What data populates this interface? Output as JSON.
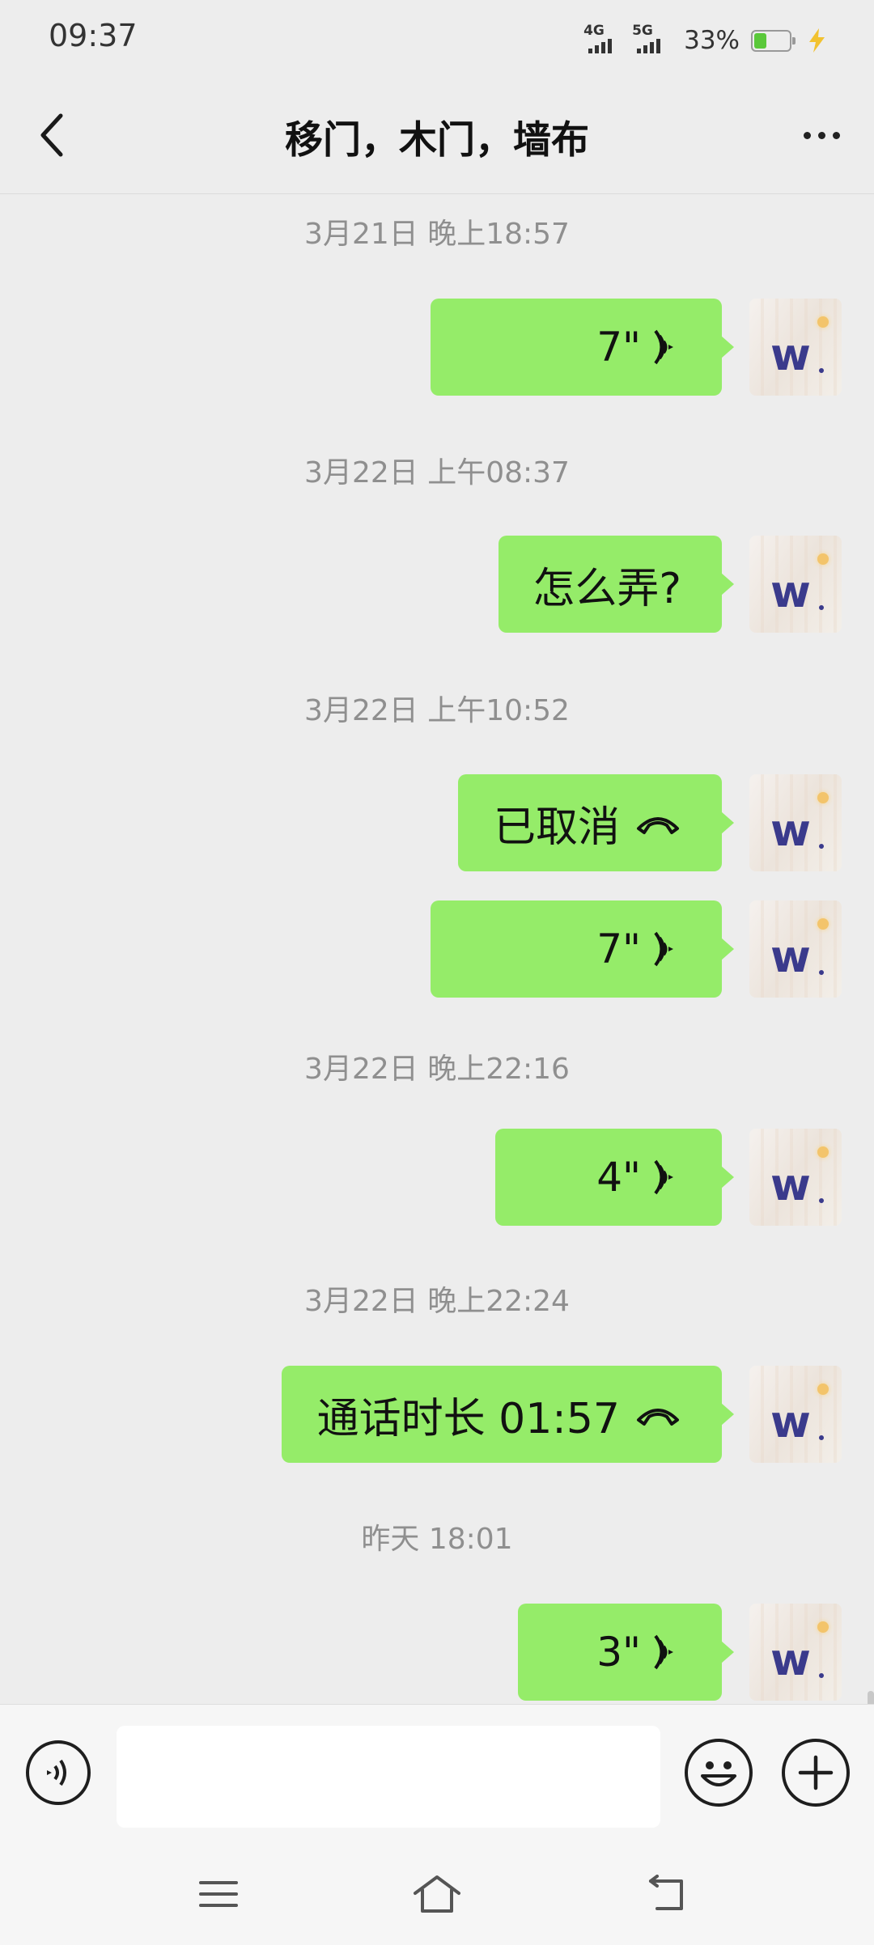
{
  "status_bar": {
    "time": "09:37",
    "signal_1": "4G",
    "signal_2": "5G",
    "battery": "33%"
  },
  "header": {
    "title": "移门，木门，墙布",
    "back_icon": "chevron-left-icon",
    "more_icon": "more-dots-icon"
  },
  "messages": [
    {
      "type": "timestamp",
      "text": "3月21日 晚上18:57"
    },
    {
      "type": "voice",
      "sender": "me",
      "duration": "7\""
    },
    {
      "type": "timestamp",
      "text": "3月22日 上午08:37"
    },
    {
      "type": "text",
      "sender": "me",
      "text": "怎么弄?"
    },
    {
      "type": "timestamp",
      "text": "3月22日 上午10:52"
    },
    {
      "type": "call",
      "sender": "me",
      "text": "已取消"
    },
    {
      "type": "voice",
      "sender": "me",
      "duration": "7\""
    },
    {
      "type": "timestamp",
      "text": "3月22日 晚上22:16"
    },
    {
      "type": "voice",
      "sender": "me",
      "duration": "4\""
    },
    {
      "type": "timestamp",
      "text": "3月22日 晚上22:24"
    },
    {
      "type": "call",
      "sender": "me",
      "text": "通话时长 01:57"
    },
    {
      "type": "timestamp",
      "text": "昨天 18:01"
    },
    {
      "type": "voice",
      "sender": "me",
      "duration": "3\""
    }
  ],
  "input_bar": {
    "voice_icon": "voice-input-icon",
    "placeholder": "",
    "emoji_icon": "emoji-icon",
    "plus_icon": "plus-icon"
  },
  "nav_bar": {
    "menu_icon": "menu-icon",
    "home_icon": "home-icon",
    "back_icon": "back-icon"
  },
  "colors": {
    "bubble": "#95ec69",
    "background": "#ededed",
    "timestamp": "#8f8f8f"
  }
}
